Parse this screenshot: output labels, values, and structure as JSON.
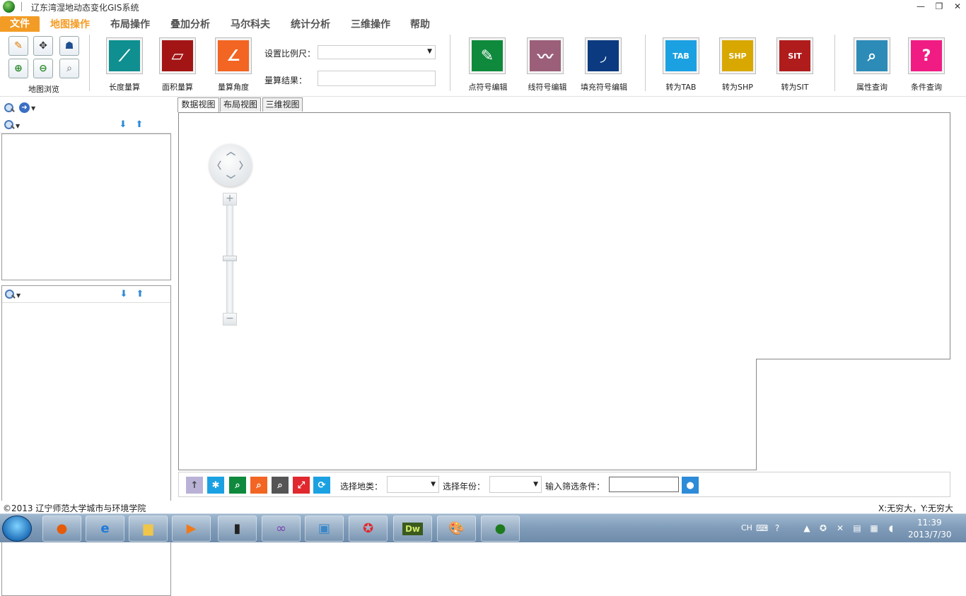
{
  "window": {
    "title": "辽东湾湿地动态变化GIS系统",
    "minimize_glyph": "—",
    "restore_glyph": "❐",
    "close_glyph": "✕"
  },
  "menu": {
    "items": [
      "文件",
      "地图操作",
      "布局操作",
      "叠加分析",
      "马尔科夫",
      "统计分析",
      "三维操作",
      "帮助"
    ]
  },
  "ribbon": {
    "map_browse_label": "地图浏览",
    "length_measure": "长度量算",
    "area_measure": "面积量算",
    "angle_measure": "量算角度",
    "scale_label": "设置比例尺：",
    "scale_value": "",
    "result_label": "量算结果：",
    "result_value": "",
    "point_symbol_edit": "点符号编辑",
    "line_symbol_edit": "线符号编辑",
    "fill_symbol_edit": "填充符号编辑",
    "to_tab": "转为TAB",
    "to_shp": "转为SHP",
    "to_sit": "转为SIT",
    "tab_icon_text": "TAB",
    "shp_icon_text": "SHP",
    "sit_icon_text": "SIT",
    "attribute_query": "属性查询",
    "condition_query": "条件查询"
  },
  "tabs": [
    "数据视图",
    "布局视图",
    "三维视图"
  ],
  "bottom_toolbar": {
    "land_type_label": "选择地类：",
    "land_type_value": "",
    "year_label": "选择年份：",
    "year_value": "",
    "filter_label": "输入筛选条件：",
    "filter_value": ""
  },
  "status": {
    "copyright": "©2013 辽宁师范大学城市与环境学院",
    "coords": "X:无穷大，Y:无穷大"
  },
  "taskbar": {
    "lang": "CH",
    "time": "11:39",
    "date": "2013/7/30",
    "dw_label": "Dw"
  },
  "colors": {
    "accent": "#f39c25",
    "length_measure": "#0f8f8f",
    "area_measure": "#a31515",
    "angle_measure": "#f26522",
    "point_symbol": "#0f8a3c",
    "line_symbol": "#9b5f7a",
    "fill_symbol": "#0b3a80",
    "to_tab": "#1ba1e2",
    "to_shp": "#d8a800",
    "to_sit": "#b01c1c",
    "attribute_query": "#2d8bb8",
    "condition_query": "#f01c84"
  }
}
